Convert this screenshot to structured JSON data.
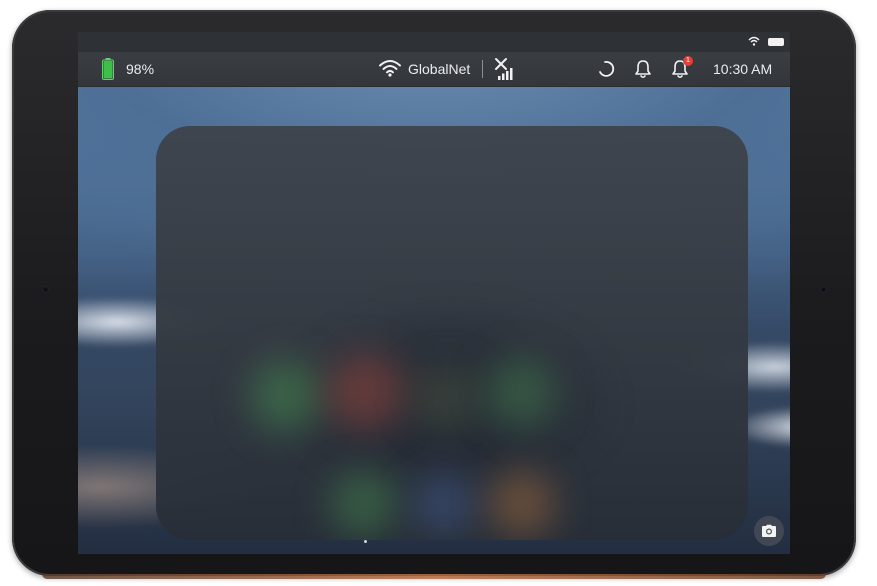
{
  "status_bar": {
    "battery_percent": "98%",
    "battery_level": 0.98,
    "network_name": "GlobalNet",
    "time": "10:30 AM",
    "notification_badge": "1"
  },
  "icons": {
    "battery": "battery-icon",
    "wifi": "wifi-icon",
    "signal": "cellular-signal-icon",
    "do_not_disturb": "moon-icon",
    "notifications": "bell-icon",
    "notifications_with_badge": "bell-badge-icon",
    "camera": "camera-icon"
  },
  "colors": {
    "battery_fill": "#3fbf4a",
    "badge": "#e0413a",
    "status_bar_bg": "#35383d",
    "panel_bg": "#3c424b"
  }
}
